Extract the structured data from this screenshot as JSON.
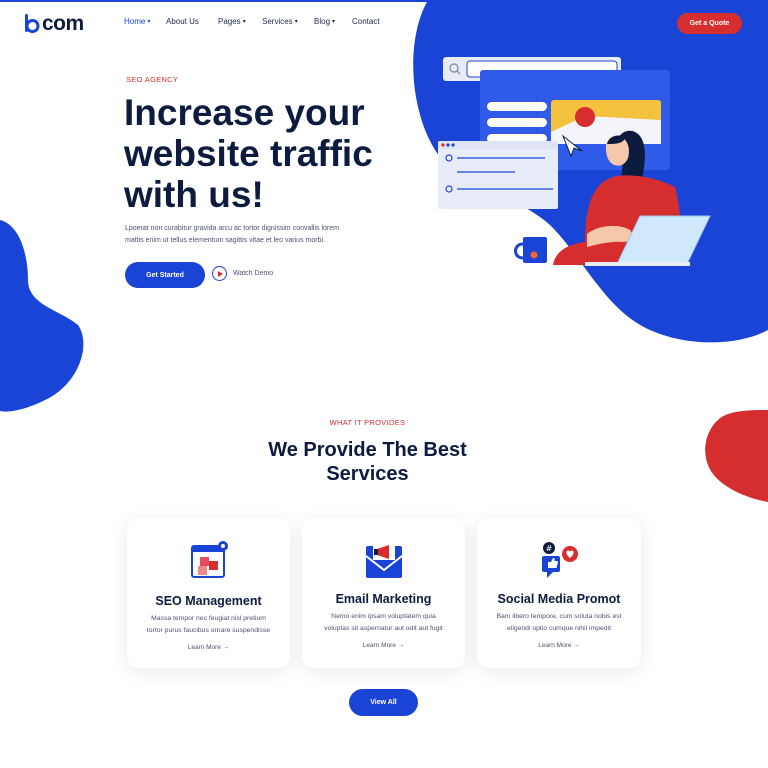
{
  "brand": {
    "logo_text": "com"
  },
  "nav": {
    "items": [
      {
        "label": "Home",
        "has_dropdown": true,
        "active": true
      },
      {
        "label": "About Us",
        "has_dropdown": false
      },
      {
        "label": "Pages",
        "has_dropdown": true
      },
      {
        "label": "Services",
        "has_dropdown": true
      },
      {
        "label": "Blog",
        "has_dropdown": true
      },
      {
        "label": "Contact",
        "has_dropdown": false
      }
    ],
    "cta_label": "Get a Quote"
  },
  "hero": {
    "eyebrow": "SEO AGENCY",
    "title_lines": [
      "Increase your",
      "website traffic",
      "with us!"
    ],
    "text_lines": [
      "Lpoerat non curabitur gravida arcu ac tortor dignissim convallis lorem",
      "mattis enim ut tellus elementum sagittis vitae et leo varius morbi."
    ],
    "primary_label": "Get Started",
    "secondary_label": "Watch Demo"
  },
  "services": {
    "eyebrow": "WHAT IT PROVIDES",
    "title_lines": [
      "We Provide The Best",
      "Services"
    ],
    "cards": [
      {
        "icon": "seo-cubes-icon",
        "title": "SEO Management",
        "text_lines": [
          "Massa tempor nec feugiat nisl pretium",
          "tortor purus faucibus ornare suspendisse"
        ],
        "link": "Learn More"
      },
      {
        "icon": "email-megaphone-icon",
        "title": "Email Marketing",
        "text_lines": [
          "Nemo enim ipsam voluptatem quia",
          "voluptas sit aspernatur aut odit aut fugit"
        ],
        "link": "Learn More"
      },
      {
        "icon": "social-likes-icon",
        "title": "Social Media Promot",
        "text_lines": [
          "Bam libero tempore, cum soluta nobis est",
          "eligendi optio cumque nihil impedit"
        ],
        "link": "Learn More"
      }
    ],
    "view_all_label": "View All"
  },
  "colors": {
    "primary": "#1a44d6",
    "accent": "#d62e2e",
    "heading": "#0c1b3e",
    "body": "#4a5470"
  }
}
